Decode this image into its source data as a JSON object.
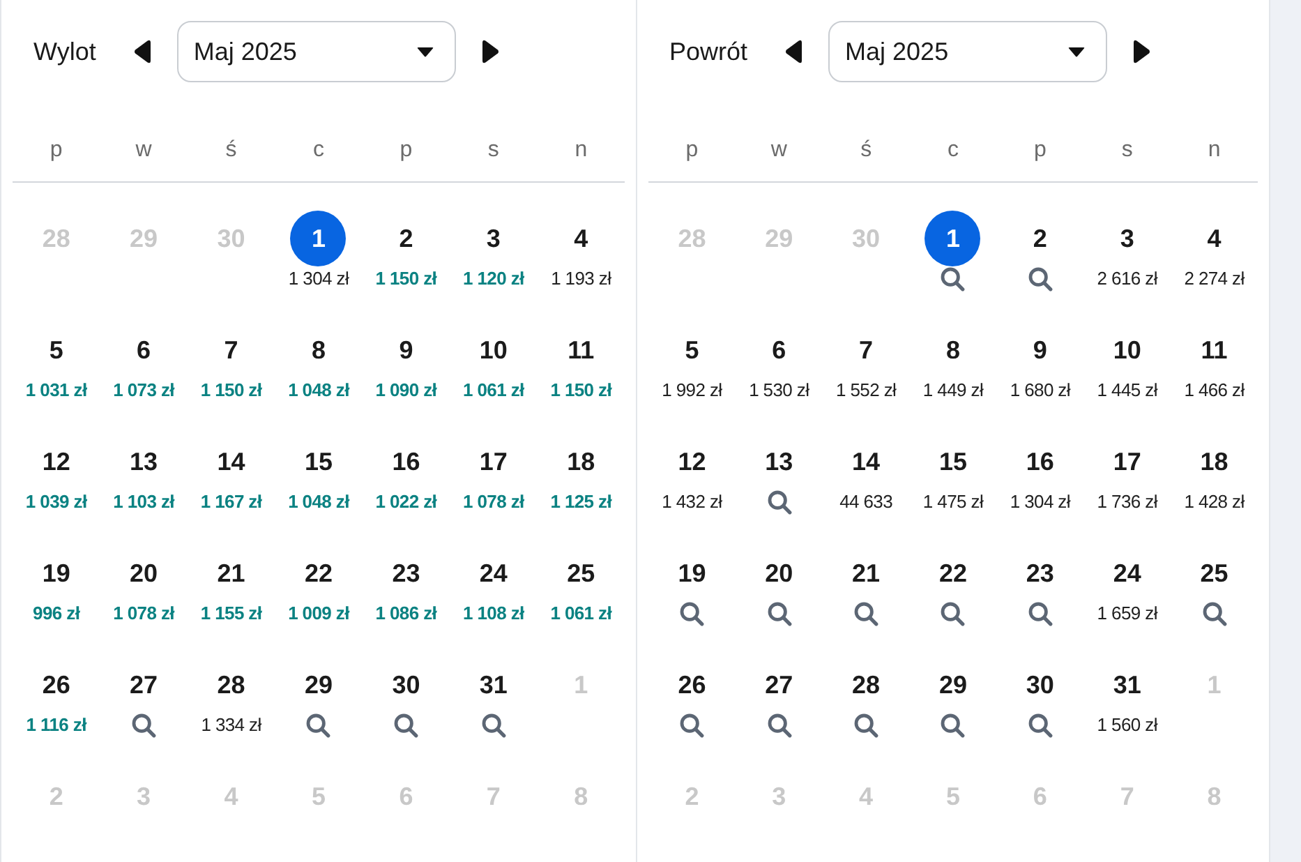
{
  "calendars": [
    {
      "label": "Wylot",
      "month": "Maj 2025",
      "weekdays": [
        "p",
        "w",
        "ś",
        "c",
        "p",
        "s",
        "n"
      ],
      "weeks": [
        [
          {
            "day": "28",
            "outside": true,
            "selected": false,
            "kind": "none"
          },
          {
            "day": "29",
            "outside": true,
            "selected": false,
            "kind": "none"
          },
          {
            "day": "30",
            "outside": true,
            "selected": false,
            "kind": "none"
          },
          {
            "day": "1",
            "outside": false,
            "selected": true,
            "kind": "price",
            "price": "1 304 zł",
            "cheap": false
          },
          {
            "day": "2",
            "outside": false,
            "selected": false,
            "kind": "price",
            "price": "1 150 zł",
            "cheap": true
          },
          {
            "day": "3",
            "outside": false,
            "selected": false,
            "kind": "price",
            "price": "1 120 zł",
            "cheap": true
          },
          {
            "day": "4",
            "outside": false,
            "selected": false,
            "kind": "price",
            "price": "1 193 zł",
            "cheap": false
          }
        ],
        [
          {
            "day": "5",
            "outside": false,
            "selected": false,
            "kind": "price",
            "price": "1 031 zł",
            "cheap": true
          },
          {
            "day": "6",
            "outside": false,
            "selected": false,
            "kind": "price",
            "price": "1 073 zł",
            "cheap": true
          },
          {
            "day": "7",
            "outside": false,
            "selected": false,
            "kind": "price",
            "price": "1 150 zł",
            "cheap": true
          },
          {
            "day": "8",
            "outside": false,
            "selected": false,
            "kind": "price",
            "price": "1 048 zł",
            "cheap": true
          },
          {
            "day": "9",
            "outside": false,
            "selected": false,
            "kind": "price",
            "price": "1 090 zł",
            "cheap": true
          },
          {
            "day": "10",
            "outside": false,
            "selected": false,
            "kind": "price",
            "price": "1 061 zł",
            "cheap": true
          },
          {
            "day": "11",
            "outside": false,
            "selected": false,
            "kind": "price",
            "price": "1 150 zł",
            "cheap": true
          }
        ],
        [
          {
            "day": "12",
            "outside": false,
            "selected": false,
            "kind": "price",
            "price": "1 039 zł",
            "cheap": true
          },
          {
            "day": "13",
            "outside": false,
            "selected": false,
            "kind": "price",
            "price": "1 103 zł",
            "cheap": true
          },
          {
            "day": "14",
            "outside": false,
            "selected": false,
            "kind": "price",
            "price": "1 167 zł",
            "cheap": true
          },
          {
            "day": "15",
            "outside": false,
            "selected": false,
            "kind": "price",
            "price": "1 048 zł",
            "cheap": true
          },
          {
            "day": "16",
            "outside": false,
            "selected": false,
            "kind": "price",
            "price": "1 022 zł",
            "cheap": true
          },
          {
            "day": "17",
            "outside": false,
            "selected": false,
            "kind": "price",
            "price": "1 078 zł",
            "cheap": true
          },
          {
            "day": "18",
            "outside": false,
            "selected": false,
            "kind": "price",
            "price": "1 125 zł",
            "cheap": true
          }
        ],
        [
          {
            "day": "19",
            "outside": false,
            "selected": false,
            "kind": "price",
            "price": "996 zł",
            "cheap": true
          },
          {
            "day": "20",
            "outside": false,
            "selected": false,
            "kind": "price",
            "price": "1 078 zł",
            "cheap": true
          },
          {
            "day": "21",
            "outside": false,
            "selected": false,
            "kind": "price",
            "price": "1 155 zł",
            "cheap": true
          },
          {
            "day": "22",
            "outside": false,
            "selected": false,
            "kind": "price",
            "price": "1 009 zł",
            "cheap": true
          },
          {
            "day": "23",
            "outside": false,
            "selected": false,
            "kind": "price",
            "price": "1 086 zł",
            "cheap": true
          },
          {
            "day": "24",
            "outside": false,
            "selected": false,
            "kind": "price",
            "price": "1 108 zł",
            "cheap": true
          },
          {
            "day": "25",
            "outside": false,
            "selected": false,
            "kind": "price",
            "price": "1 061 zł",
            "cheap": true
          }
        ],
        [
          {
            "day": "26",
            "outside": false,
            "selected": false,
            "kind": "price",
            "price": "1 116 zł",
            "cheap": true
          },
          {
            "day": "27",
            "outside": false,
            "selected": false,
            "kind": "search"
          },
          {
            "day": "28",
            "outside": false,
            "selected": false,
            "kind": "price",
            "price": "1 334 zł",
            "cheap": false
          },
          {
            "day": "29",
            "outside": false,
            "selected": false,
            "kind": "search"
          },
          {
            "day": "30",
            "outside": false,
            "selected": false,
            "kind": "search"
          },
          {
            "day": "31",
            "outside": false,
            "selected": false,
            "kind": "search"
          },
          {
            "day": "1",
            "outside": true,
            "selected": false,
            "kind": "none"
          }
        ],
        [
          {
            "day": "2",
            "outside": true,
            "selected": false,
            "kind": "none"
          },
          {
            "day": "3",
            "outside": true,
            "selected": false,
            "kind": "none"
          },
          {
            "day": "4",
            "outside": true,
            "selected": false,
            "kind": "none"
          },
          {
            "day": "5",
            "outside": true,
            "selected": false,
            "kind": "none"
          },
          {
            "day": "6",
            "outside": true,
            "selected": false,
            "kind": "none"
          },
          {
            "day": "7",
            "outside": true,
            "selected": false,
            "kind": "none"
          },
          {
            "day": "8",
            "outside": true,
            "selected": false,
            "kind": "none"
          }
        ]
      ]
    },
    {
      "label": "Powrót",
      "month": "Maj 2025",
      "weekdays": [
        "p",
        "w",
        "ś",
        "c",
        "p",
        "s",
        "n"
      ],
      "weeks": [
        [
          {
            "day": "28",
            "outside": true,
            "selected": false,
            "kind": "none"
          },
          {
            "day": "29",
            "outside": true,
            "selected": false,
            "kind": "none"
          },
          {
            "day": "30",
            "outside": true,
            "selected": false,
            "kind": "none"
          },
          {
            "day": "1",
            "outside": false,
            "selected": true,
            "kind": "search"
          },
          {
            "day": "2",
            "outside": false,
            "selected": false,
            "kind": "search"
          },
          {
            "day": "3",
            "outside": false,
            "selected": false,
            "kind": "price",
            "price": "2 616 zł",
            "cheap": false
          },
          {
            "day": "4",
            "outside": false,
            "selected": false,
            "kind": "price",
            "price": "2 274 zł",
            "cheap": false
          }
        ],
        [
          {
            "day": "5",
            "outside": false,
            "selected": false,
            "kind": "price",
            "price": "1 992 zł",
            "cheap": false
          },
          {
            "day": "6",
            "outside": false,
            "selected": false,
            "kind": "price",
            "price": "1 530 zł",
            "cheap": false
          },
          {
            "day": "7",
            "outside": false,
            "selected": false,
            "kind": "price",
            "price": "1 552 zł",
            "cheap": false
          },
          {
            "day": "8",
            "outside": false,
            "selected": false,
            "kind": "price",
            "price": "1 449 zł",
            "cheap": false
          },
          {
            "day": "9",
            "outside": false,
            "selected": false,
            "kind": "price",
            "price": "1 680 zł",
            "cheap": false
          },
          {
            "day": "10",
            "outside": false,
            "selected": false,
            "kind": "price",
            "price": "1 445 zł",
            "cheap": false
          },
          {
            "day": "11",
            "outside": false,
            "selected": false,
            "kind": "price",
            "price": "1 466 zł",
            "cheap": false
          }
        ],
        [
          {
            "day": "12",
            "outside": false,
            "selected": false,
            "kind": "price",
            "price": "1 432 zł",
            "cheap": false
          },
          {
            "day": "13",
            "outside": false,
            "selected": false,
            "kind": "search"
          },
          {
            "day": "14",
            "outside": false,
            "selected": false,
            "kind": "price",
            "price": "44 633",
            "cheap": false
          },
          {
            "day": "15",
            "outside": false,
            "selected": false,
            "kind": "price",
            "price": "1 475 zł",
            "cheap": false
          },
          {
            "day": "16",
            "outside": false,
            "selected": false,
            "kind": "price",
            "price": "1 304 zł",
            "cheap": false
          },
          {
            "day": "17",
            "outside": false,
            "selected": false,
            "kind": "price",
            "price": "1 736 zł",
            "cheap": false
          },
          {
            "day": "18",
            "outside": false,
            "selected": false,
            "kind": "price",
            "price": "1 428 zł",
            "cheap": false
          }
        ],
        [
          {
            "day": "19",
            "outside": false,
            "selected": false,
            "kind": "search"
          },
          {
            "day": "20",
            "outside": false,
            "selected": false,
            "kind": "search"
          },
          {
            "day": "21",
            "outside": false,
            "selected": false,
            "kind": "search"
          },
          {
            "day": "22",
            "outside": false,
            "selected": false,
            "kind": "search"
          },
          {
            "day": "23",
            "outside": false,
            "selected": false,
            "kind": "search"
          },
          {
            "day": "24",
            "outside": false,
            "selected": false,
            "kind": "price",
            "price": "1 659 zł",
            "cheap": false
          },
          {
            "day": "25",
            "outside": false,
            "selected": false,
            "kind": "search"
          }
        ],
        [
          {
            "day": "26",
            "outside": false,
            "selected": false,
            "kind": "search"
          },
          {
            "day": "27",
            "outside": false,
            "selected": false,
            "kind": "search"
          },
          {
            "day": "28",
            "outside": false,
            "selected": false,
            "kind": "search"
          },
          {
            "day": "29",
            "outside": false,
            "selected": false,
            "kind": "search"
          },
          {
            "day": "30",
            "outside": false,
            "selected": false,
            "kind": "search"
          },
          {
            "day": "31",
            "outside": false,
            "selected": false,
            "kind": "price",
            "price": "1 560 zł",
            "cheap": false
          },
          {
            "day": "1",
            "outside": true,
            "selected": false,
            "kind": "none"
          }
        ],
        [
          {
            "day": "2",
            "outside": true,
            "selected": false,
            "kind": "none"
          },
          {
            "day": "3",
            "outside": true,
            "selected": false,
            "kind": "none"
          },
          {
            "day": "4",
            "outside": true,
            "selected": false,
            "kind": "none"
          },
          {
            "day": "5",
            "outside": true,
            "selected": false,
            "kind": "none"
          },
          {
            "day": "6",
            "outside": true,
            "selected": false,
            "kind": "none"
          },
          {
            "day": "7",
            "outside": true,
            "selected": false,
            "kind": "none"
          },
          {
            "day": "8",
            "outside": true,
            "selected": false,
            "kind": "none"
          }
        ]
      ]
    }
  ]
}
